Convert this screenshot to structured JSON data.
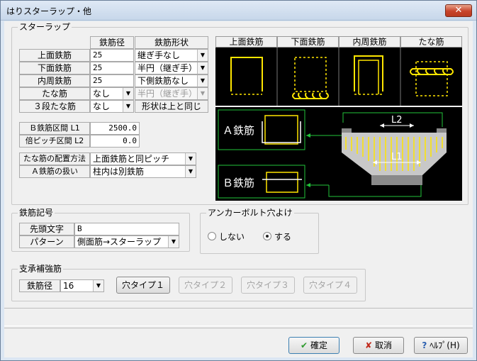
{
  "window": {
    "title": "はりスターラップ・他",
    "close": "✕"
  },
  "stirrup_group": {
    "legend": "スターラップ",
    "col_headers": [
      "鉄筋径",
      "鉄筋形状"
    ],
    "rows": [
      {
        "label": "上面鉄筋",
        "diameter": "25",
        "shape": "継ぎ手なし"
      },
      {
        "label": "下面鉄筋",
        "diameter": "25",
        "shape": "半円（継ぎ手）"
      },
      {
        "label": "内周鉄筋",
        "diameter": "25",
        "shape": "下側鉄筋なし"
      },
      {
        "label": "たな筋",
        "diameter": "なし",
        "shape": "半円（継ぎ手）"
      },
      {
        "label": "３段たな筋",
        "diameter": "なし",
        "shape": "形状は上と同じ"
      }
    ],
    "b_interval_label": "Ｂ鉄筋区間 L1",
    "b_interval_value": "2500.0",
    "double_pitch_label": "倍ピッチ区間 L2",
    "double_pitch_value": "0.0",
    "tana_method_label": "たな筋の配置方法",
    "tana_method_value": "上面鉄筋と同ピッチ",
    "a_bar_label": "Ａ鉄筋の扱い",
    "a_bar_value": "柱内は別鉄筋"
  },
  "preview": {
    "headers": [
      "上面鉄筋",
      "下面鉄筋",
      "内周鉄筋",
      "たな筋"
    ],
    "a_label": "Ａ鉄筋",
    "b_label": "Ｂ鉄筋",
    "l1": "L1",
    "l2": "L2"
  },
  "rebar_symbol": {
    "legend": "鉄筋記号",
    "prefix_label": "先頭文字",
    "prefix_value": "B",
    "pattern_label": "パターン",
    "pattern_value": "側面筋→スターラップ"
  },
  "anchor": {
    "legend": "アンカーボルト穴よけ",
    "option_no": "しない",
    "option_yes": "する",
    "selected": "する"
  },
  "bearing": {
    "legend": "支承補強筋",
    "diameter_label": "鉄筋径",
    "diameter_value": "16",
    "hole_buttons": [
      "穴タイプ１",
      "穴タイプ２",
      "穴タイプ３",
      "穴タイプ４"
    ]
  },
  "footer": {
    "ok": "確定",
    "cancel": "取消",
    "help": "ﾍﾙﾌﾟ(H)"
  },
  "colors": {
    "yellow": "#ffe600",
    "green": "#22c33a",
    "canvas": "#000000",
    "close_red": "#c7432a"
  }
}
